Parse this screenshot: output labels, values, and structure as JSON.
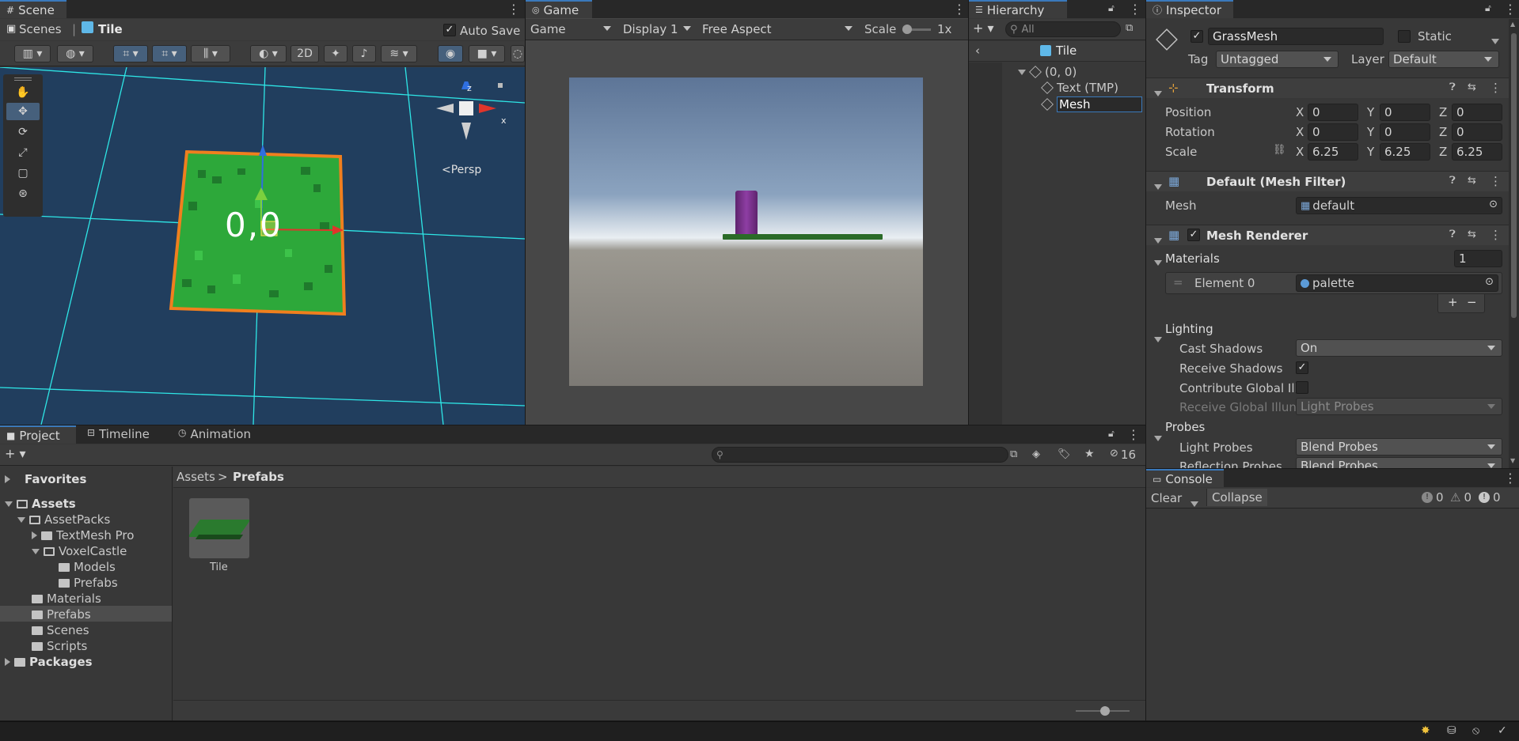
{
  "scene": {
    "tab": "Scene",
    "breadcrumb": {
      "root": "Scenes",
      "current": "Tile"
    },
    "auto_save": "Auto Save",
    "mode_2d": "2D",
    "tile_label": "0,0",
    "gizmo": {
      "z": "z",
      "x": "x",
      "persp": "<Persp"
    }
  },
  "game": {
    "tab": "Game",
    "view_dropdown": "Game",
    "display": "Display 1",
    "aspect": "Free Aspect",
    "scale_label": "Scale",
    "scale_value": "1x"
  },
  "hierarchy": {
    "tab": "Hierarchy",
    "search_placeholder": "All",
    "prefab_root": "Tile",
    "items": [
      {
        "label": "(0, 0)"
      },
      {
        "label": "Text (TMP)"
      },
      {
        "label": "Mesh"
      }
    ]
  },
  "inspector": {
    "tab": "Inspector",
    "object_name": "GrassMesh",
    "static_label": "Static",
    "tag_label": "Tag",
    "tag_value": "Untagged",
    "layer_label": "Layer",
    "layer_value": "Default",
    "transform": {
      "title": "Transform",
      "rows": [
        {
          "label": "Position",
          "x": "0",
          "y": "0",
          "z": "0"
        },
        {
          "label": "Rotation",
          "x": "0",
          "y": "0",
          "z": "0"
        },
        {
          "label": "Scale",
          "x": "6.25",
          "y": "6.25",
          "z": "6.25"
        }
      ],
      "axis": {
        "x": "X",
        "y": "Y",
        "z": "Z"
      }
    },
    "mesh_filter": {
      "title": "Default (Mesh Filter)",
      "mesh_label": "Mesh",
      "mesh_value": "default"
    },
    "mesh_renderer": {
      "title": "Mesh Renderer",
      "materials_label": "Materials",
      "materials_count": "1",
      "element_label": "Element 0",
      "element_value": "palette",
      "lighting_label": "Lighting",
      "cast_shadows_label": "Cast Shadows",
      "cast_shadows_value": "On",
      "receive_shadows_label": "Receive Shadows",
      "contribute_gi_label": "Contribute Global Ill",
      "receive_gi_label": "Receive Global Illun",
      "receive_gi_value": "Light Probes",
      "probes_label": "Probes",
      "light_probes_label": "Light Probes",
      "light_probes_value": "Blend Probes",
      "reflection_probes_label": "Reflection Probes",
      "reflection_probes_value": "Blend Probes"
    }
  },
  "console": {
    "tab": "Console",
    "clear": "Clear",
    "collapse": "Collapse",
    "info_count": "0",
    "warn_count": "0",
    "error_count": "0"
  },
  "project": {
    "tabs": [
      "Project",
      "Timeline",
      "Animation"
    ],
    "hidden_count": "16",
    "tree": [
      {
        "label": "Favorites"
      },
      {
        "label": "Assets"
      },
      {
        "label": "AssetPacks"
      },
      {
        "label": "TextMesh Pro"
      },
      {
        "label": "VoxelCastle"
      },
      {
        "label": "Models"
      },
      {
        "label": "Prefabs"
      },
      {
        "label": "Materials"
      },
      {
        "label": "Prefabs"
      },
      {
        "label": "Scenes"
      },
      {
        "label": "Scripts"
      },
      {
        "label": "Packages"
      }
    ],
    "breadcrumb": {
      "root": "Assets",
      "sep": ">",
      "current": "Prefabs"
    },
    "assets": [
      {
        "label": "Tile"
      }
    ],
    "zoom_level": 0.55
  },
  "colors": {
    "accent": "#3a79bb",
    "scene_bg": "#213e5e",
    "grid": "#2ee6e6",
    "tile_green": "#2da83a",
    "selection_orange": "#f07f1e",
    "panel": "#383838"
  }
}
